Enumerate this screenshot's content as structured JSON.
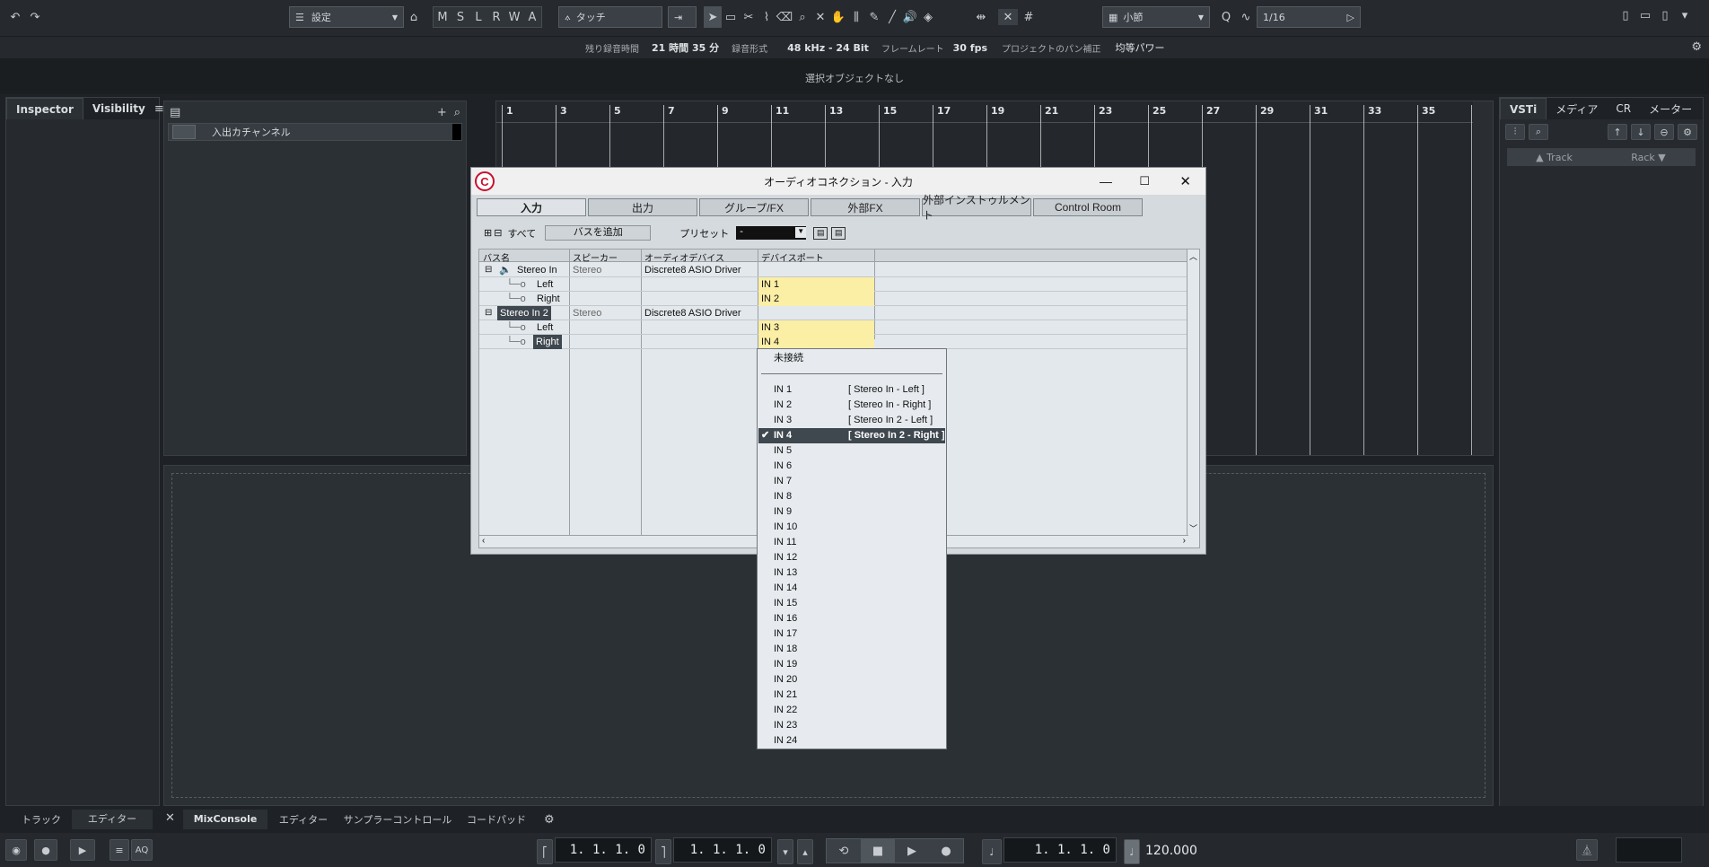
{
  "toolbar": {
    "settings_label": "設定",
    "msl": [
      "M",
      "S",
      "L",
      "R",
      "W",
      "A"
    ],
    "automation_mode": "タッチ",
    "grid_type": "小節",
    "quantize": "1/16"
  },
  "infobar": {
    "rec_time_label": "残り録音時間",
    "rec_time_value": "21 時間 35 分",
    "rec_format_label": "録音形式",
    "rec_format_value": "48 kHz - 24 Bit",
    "frame_rate_label": "フレームレート",
    "frame_rate_value": "30 fps",
    "pan_label": "プロジェクトのパン補正",
    "pan_value": "均等パワー"
  },
  "status": "選択オブジェクトなし",
  "left_zone": {
    "tabs": [
      "Inspector",
      "Visibility"
    ]
  },
  "track_list": {
    "track_name": "入出カチャンネル"
  },
  "ruler": [
    "1",
    "3",
    "5",
    "7",
    "9",
    "11",
    "13",
    "15",
    "17",
    "19",
    "21",
    "23",
    "25",
    "27",
    "29",
    "31",
    "33",
    "35",
    "3"
  ],
  "right_zone": {
    "tabs": [
      "VSTi",
      "メディア",
      "CR",
      "メーター"
    ],
    "track_label": "Track",
    "rack_label": "Rack"
  },
  "dialog": {
    "title": "オーディオコネクション - 入力",
    "tabs": [
      "入力",
      "出力",
      "グループ/FX",
      "外部FX",
      "外部インストゥルメント",
      "Control Room"
    ],
    "all_label": "すべて",
    "add_bus_label": "バスを追加",
    "preset_label": "プリセット",
    "preset_value": "-",
    "columns": [
      "バス名",
      "スピーカー",
      "オーディオデバイス",
      "デバイスポート"
    ],
    "rows": [
      {
        "name": "Stereo In",
        "speaker": "Stereo",
        "device": "Discrete8 ASIO Driver",
        "port": ""
      },
      {
        "name": "Left",
        "speaker": "",
        "device": "",
        "port": "IN 1"
      },
      {
        "name": "Right",
        "speaker": "",
        "device": "",
        "port": "IN 2"
      },
      {
        "name": "Stereo In 2",
        "speaker": "Stereo",
        "device": "Discrete8 ASIO Driver",
        "port": ""
      },
      {
        "name": "Left",
        "speaker": "",
        "device": "",
        "port": "IN 3"
      },
      {
        "name": "Right",
        "speaker": "",
        "device": "",
        "port": "IN 4"
      }
    ]
  },
  "port_menu": {
    "unconnected": "未接続",
    "items": [
      {
        "label": "IN 1",
        "assign": "[ Stereo In - Left ]"
      },
      {
        "label": "IN 2",
        "assign": "[ Stereo In - Right ]"
      },
      {
        "label": "IN 3",
        "assign": "[ Stereo In 2 - Left ]"
      },
      {
        "label": "IN 4",
        "assign": "[ Stereo In 2 - Right ]"
      },
      {
        "label": "IN 5",
        "assign": ""
      },
      {
        "label": "IN 6",
        "assign": ""
      },
      {
        "label": "IN 7",
        "assign": ""
      },
      {
        "label": "IN 8",
        "assign": ""
      },
      {
        "label": "IN 9",
        "assign": ""
      },
      {
        "label": "IN 10",
        "assign": ""
      },
      {
        "label": "IN 11",
        "assign": ""
      },
      {
        "label": "IN 12",
        "assign": ""
      },
      {
        "label": "IN 13",
        "assign": ""
      },
      {
        "label": "IN 14",
        "assign": ""
      },
      {
        "label": "IN 15",
        "assign": ""
      },
      {
        "label": "IN 16",
        "assign": ""
      },
      {
        "label": "IN 17",
        "assign": ""
      },
      {
        "label": "IN 18",
        "assign": ""
      },
      {
        "label": "IN 19",
        "assign": ""
      },
      {
        "label": "IN 20",
        "assign": ""
      },
      {
        "label": "IN 21",
        "assign": ""
      },
      {
        "label": "IN 22",
        "assign": ""
      },
      {
        "label": "IN 23",
        "assign": ""
      },
      {
        "label": "IN 24",
        "assign": ""
      }
    ],
    "selected": "IN 4"
  },
  "bottom_tabs": {
    "left": [
      "トラック",
      "エディター"
    ],
    "lower": [
      "MixConsole",
      "エディター",
      "サンプラーコントロール",
      "コードパッド"
    ]
  },
  "transport": {
    "left_locator": "1. 1. 1.   0",
    "right_locator": "1. 1. 1.   0",
    "position": "1. 1. 1.   0",
    "tempo": "120.000"
  },
  "colors": {
    "accent": "#c8102e",
    "port_highlight": "#fbeea5",
    "selection": "#3f474f"
  }
}
